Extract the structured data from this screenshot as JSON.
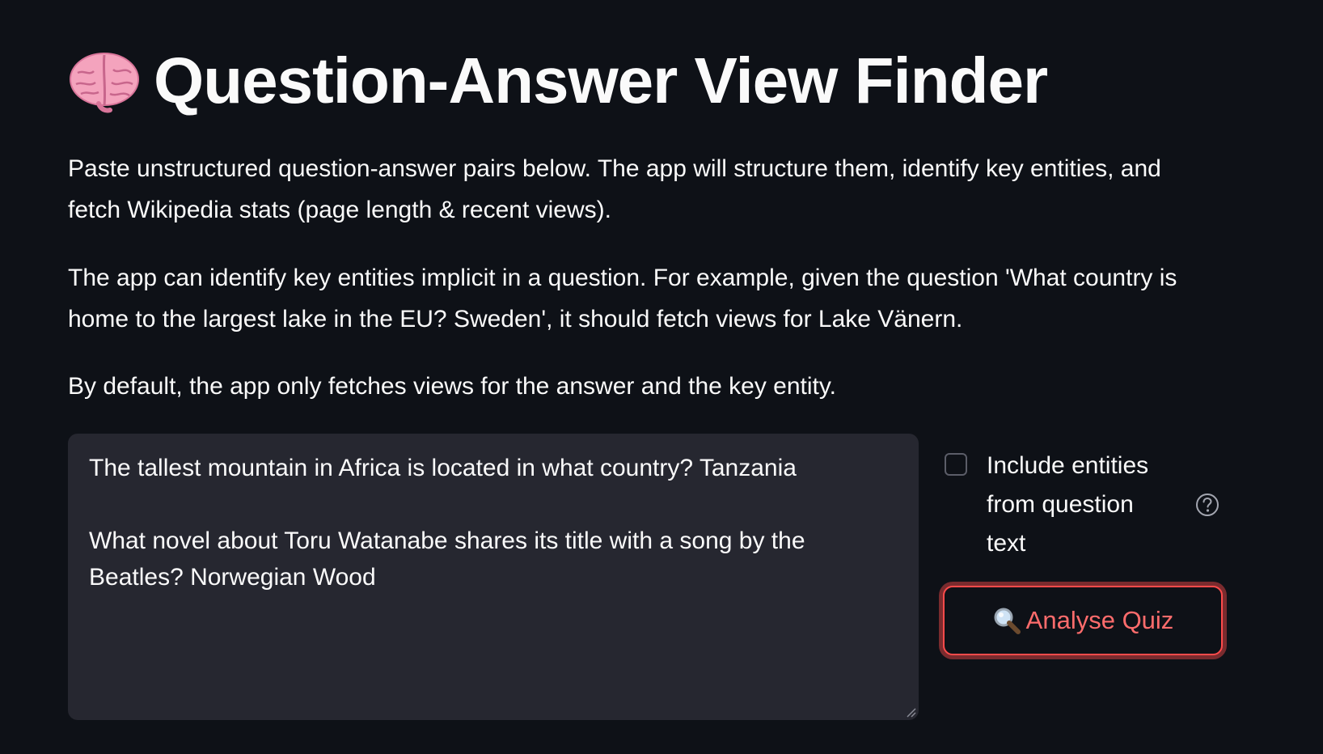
{
  "header": {
    "title": "Question-Answer View Finder",
    "title_icon": "brain-icon"
  },
  "description": {
    "paragraph_1": "Paste unstructured question-answer pairs below. The app will structure them, identify key entities, and fetch Wikipedia stats (page length & recent views).",
    "paragraph_2": "The app can identify key entities implicit in a question. For example, given the question 'What country is home to the largest lake in the EU? Sweden', it should fetch views for Lake Vänern.",
    "paragraph_3": "By default, the app only fetches views for the answer and the key entity."
  },
  "quiz_input": {
    "value": "The tallest mountain in Africa is located in what country? Tanzania\n\nWhat novel about Toru Watanabe shares its title with a song by the Beatles? Norwegian Wood"
  },
  "options": {
    "include_entities_label": "Include entities from question text",
    "include_entities_checked": false,
    "help_icon": "question-circle-icon"
  },
  "actions": {
    "analyse_label": "Analyse Quiz",
    "analyse_icon": "magnifying-glass-icon"
  },
  "colors": {
    "background": "#0e1117",
    "surface": "#262730",
    "accent": "#ff4b4b",
    "text": "#fafafa"
  }
}
